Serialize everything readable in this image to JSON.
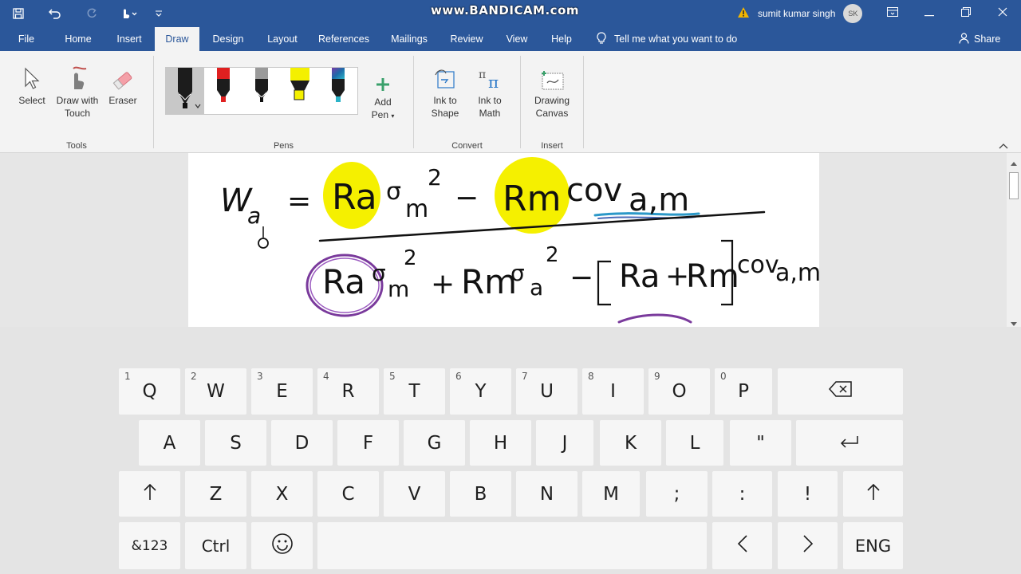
{
  "watermark": "www.BANDICAM.com",
  "user": {
    "name": "sumit kumar singh",
    "initials": "SK"
  },
  "tabs": [
    "File",
    "Home",
    "Insert",
    "Draw",
    "Design",
    "Layout",
    "References",
    "Mailings",
    "Review",
    "View",
    "Help"
  ],
  "active_tab": "Draw",
  "tell_me": "Tell me what you want to do",
  "share_label": "Share",
  "ribbon": {
    "tools": {
      "label": "Tools",
      "select": "Select",
      "draw_touch_1": "Draw with",
      "draw_touch_2": "Touch",
      "eraser": "Eraser"
    },
    "pens": {
      "label": "Pens",
      "add_pen_1": "Add",
      "add_pen_2": "Pen"
    },
    "convert": {
      "label": "Convert",
      "ink_shape_1": "Ink to",
      "ink_shape_2": "Shape",
      "ink_math_1": "Ink to",
      "ink_math_2": "Math"
    },
    "insert": {
      "label": "Insert",
      "canvas_1": "Drawing",
      "canvas_2": "Canvas"
    }
  },
  "pen_colors": [
    "#111111",
    "#e02020",
    "#9a9a9a",
    "#f4f000",
    "#1e6aa8"
  ],
  "keyboard": {
    "row1": [
      {
        "num": "1",
        "key": "Q"
      },
      {
        "num": "2",
        "key": "W"
      },
      {
        "num": "3",
        "key": "E"
      },
      {
        "num": "4",
        "key": "R"
      },
      {
        "num": "5",
        "key": "T"
      },
      {
        "num": "6",
        "key": "Y"
      },
      {
        "num": "7",
        "key": "U"
      },
      {
        "num": "8",
        "key": "I"
      },
      {
        "num": "9",
        "key": "O"
      },
      {
        "num": "0",
        "key": "P"
      }
    ],
    "row2": [
      "A",
      "S",
      "D",
      "F",
      "G",
      "H",
      "J",
      "K",
      "L",
      "\""
    ],
    "row3": [
      "Z",
      "X",
      "C",
      "V",
      "B",
      "N",
      "M",
      ";",
      ":",
      "!"
    ],
    "row4": {
      "symbols": "&123",
      "ctrl": "Ctrl",
      "lang": "ENG"
    }
  }
}
